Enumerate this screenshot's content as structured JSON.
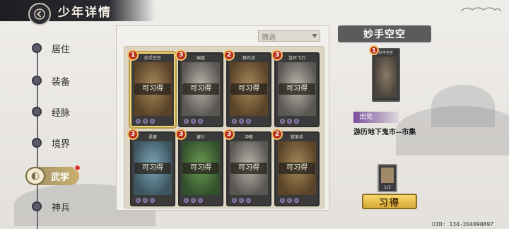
{
  "header": {
    "title": "少年详情"
  },
  "nav": {
    "items": [
      {
        "label": "居住"
      },
      {
        "label": "装备"
      },
      {
        "label": "经脉"
      },
      {
        "label": "境界"
      },
      {
        "label": "武学"
      },
      {
        "label": "神兵"
      }
    ],
    "active_index": 4
  },
  "filter": {
    "label": "筛选"
  },
  "cards": [
    {
      "name": "妙手空空",
      "level": "1",
      "status": "可习得",
      "theme": "brown",
      "selected": true
    },
    {
      "name": "幽蓝",
      "level": "3",
      "status": "可习得",
      "theme": "grey",
      "selected": false
    },
    {
      "name": "群石功",
      "level": "2",
      "status": "可习得",
      "theme": "brown",
      "selected": false
    },
    {
      "name": "连环飞刀",
      "level": "3",
      "status": "可习得",
      "theme": "grey",
      "selected": false
    },
    {
      "name": "柔掌",
      "level": "3",
      "status": "可习得",
      "theme": "blue",
      "selected": false
    },
    {
      "name": "毒针",
      "level": "3",
      "status": "可习得",
      "theme": "green",
      "selected": false
    },
    {
      "name": "冲拳",
      "level": "3",
      "status": "可习得",
      "theme": "grey",
      "selected": false
    },
    {
      "name": "拔掌手",
      "level": "2",
      "status": "可习得",
      "theme": "brown",
      "selected": false
    }
  ],
  "detail": {
    "title": "妙手空空",
    "card_name": "妙手空空",
    "card_level": "1",
    "source_label": "出处",
    "source_text": "游历地下鬼市--市集",
    "item_count": "1/3",
    "learn_button": "习得"
  },
  "footer": {
    "uid": "UID: 134-204090897"
  },
  "colors": {
    "accent_gold": "#d7a93a",
    "level_red": "#b5321f",
    "source_purple": "#7a4f9a"
  }
}
